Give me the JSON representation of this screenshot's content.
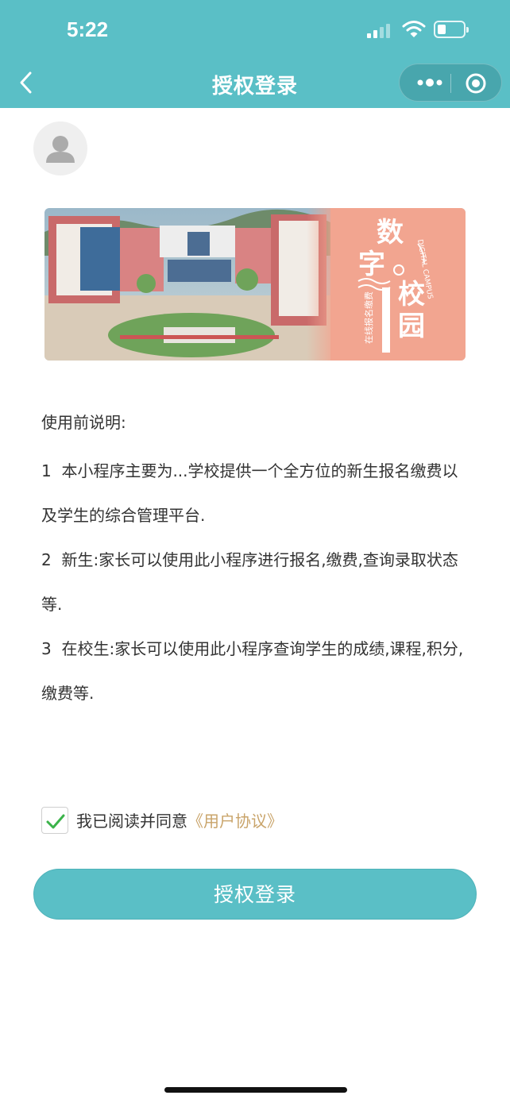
{
  "status_bar": {
    "time": "5:22"
  },
  "nav": {
    "title": "授权登录"
  },
  "banner": {
    "title_chars": [
      "数",
      "字",
      "校",
      "园"
    ],
    "english": "DIGITAL CAMPUS",
    "subtitle": "在线报名缴费"
  },
  "notes": {
    "title": "使用前说明:",
    "items": [
      {
        "num": "1",
        "text": "本小程序主要为...学校提供一个全方位的新生报名缴费以及学生的综合管理平台."
      },
      {
        "num": "2",
        "text": "新生:家长可以使用此小程序进行报名,缴费,查询录取状态等."
      },
      {
        "num": "3",
        "text": "在校生:家长可以使用此小程序查询学生的成绩,课程,积分,缴费等."
      }
    ]
  },
  "agreement": {
    "checked": true,
    "text": "我已阅读并同意",
    "link": "《用户协议》"
  },
  "login_button": {
    "label": "授权登录"
  },
  "colors": {
    "primary": "#5ABFC6",
    "link": "#C9A46A",
    "banner_accent": "#F2A590",
    "check": "#3BB34A"
  }
}
